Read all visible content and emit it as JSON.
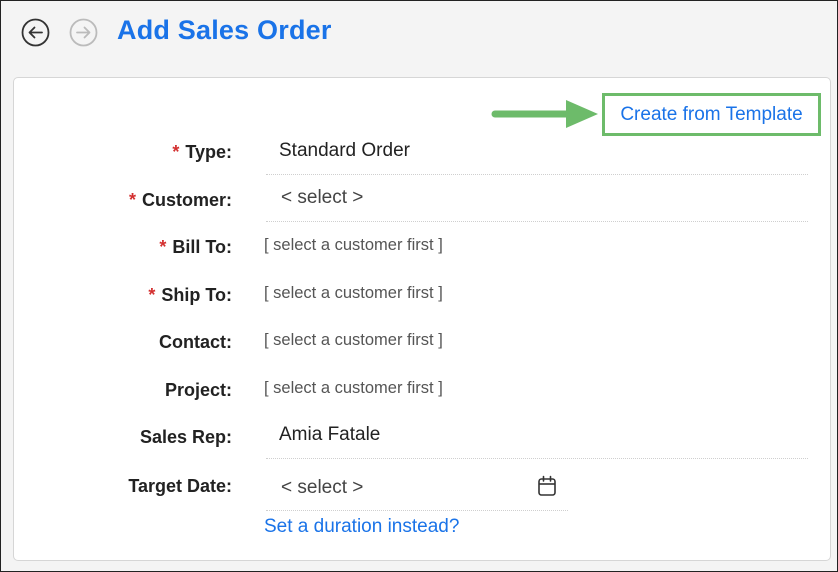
{
  "header": {
    "title": "Add Sales Order",
    "back_icon": "circle-arrow-left-icon",
    "forward_icon": "circle-arrow-right-icon"
  },
  "toolbar": {
    "template_button": "Create from Template",
    "arrow_icon": "green-arrow-right-icon",
    "arrow_color": "#6dbb6a"
  },
  "form": {
    "required_marker": "*",
    "type": {
      "label": "Type:",
      "value": "Standard Order"
    },
    "customer": {
      "label": "Customer:",
      "value": "< select >"
    },
    "bill_to": {
      "label": "Bill To:",
      "hint": "[ select a customer first ]"
    },
    "ship_to": {
      "label": "Ship To:",
      "hint": "[ select a customer first ]"
    },
    "contact": {
      "label": "Contact:",
      "hint": "[ select a customer first ]"
    },
    "project": {
      "label": "Project:",
      "hint": "[ select a customer first ]"
    },
    "sales_rep": {
      "label": "Sales Rep:",
      "value": "Amia Fatale"
    },
    "target_date": {
      "label": "Target Date:",
      "value": "< select >",
      "icon": "calendar-icon"
    },
    "duration_link": "Set a duration instead?"
  },
  "colors": {
    "accent": "#1a73e8",
    "required": "#d32f2f",
    "highlight": "#6dbb6a"
  }
}
